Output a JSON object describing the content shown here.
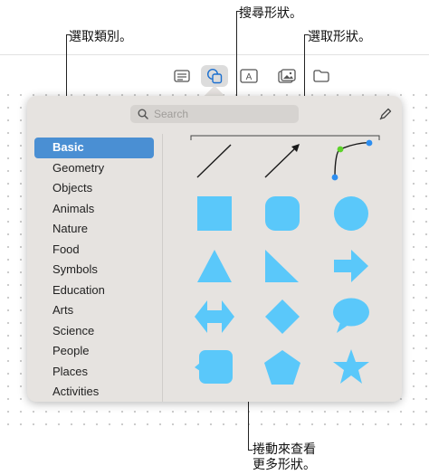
{
  "callouts": {
    "choose_category": "選取類別。",
    "search_shapes": "搜尋形狀。",
    "choose_shape": "選取形狀。",
    "scroll_more_line1": "捲動來查看",
    "scroll_more_line2": "更多形狀。"
  },
  "toolbar": {
    "icons": [
      "text-box-icon",
      "shapes-icon",
      "text-frame-icon",
      "media-icon",
      "folder-icon"
    ]
  },
  "search": {
    "placeholder": "Search"
  },
  "sidebar": {
    "items": [
      {
        "label": "Basic",
        "selected": true
      },
      {
        "label": "Geometry"
      },
      {
        "label": "Objects"
      },
      {
        "label": "Animals"
      },
      {
        "label": "Nature"
      },
      {
        "label": "Food"
      },
      {
        "label": "Symbols"
      },
      {
        "label": "Education"
      },
      {
        "label": "Arts"
      },
      {
        "label": "Science"
      },
      {
        "label": "People"
      },
      {
        "label": "Places"
      },
      {
        "label": "Activities"
      }
    ]
  },
  "shapes": [
    "line",
    "arrow-line",
    "curve",
    "square",
    "rounded-square",
    "circle",
    "triangle",
    "right-triangle",
    "arrow",
    "double-arrow",
    "diamond",
    "speech-bubble",
    "callout-square",
    "pentagon",
    "star"
  ],
  "colors": {
    "shape_fill": "#5ac8fa",
    "accent": "#4a8fd3",
    "popover_bg": "#e6e3e0"
  }
}
